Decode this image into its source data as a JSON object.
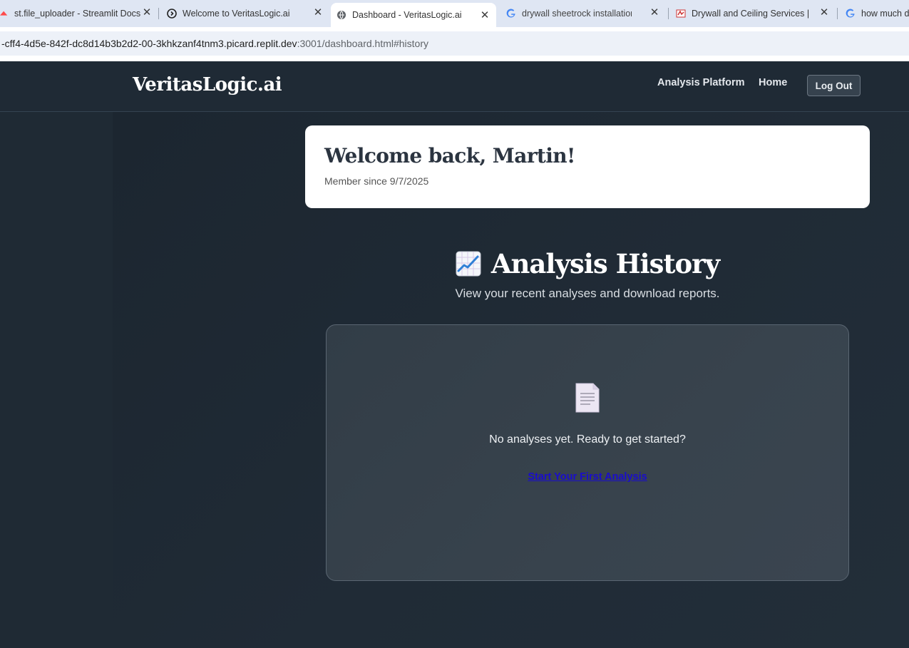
{
  "browser": {
    "tabs": [
      {
        "title": "st.file_uploader - Streamlit Docs",
        "favicon": "streamlit-icon"
      },
      {
        "title": "Welcome to VeritasLogic.ai",
        "favicon": "replit-icon"
      },
      {
        "title": "Dashboard - VeritasLogic.ai",
        "favicon": "globe-icon",
        "active": true
      },
      {
        "title": "drywall sheetrock installation co",
        "favicon": "google-icon"
      },
      {
        "title": "Drywall and Ceiling Services | M",
        "favicon": "site-icon"
      },
      {
        "title": "how much d",
        "favicon": "google-icon"
      }
    ],
    "url_host": "-cff4-4d5e-842f-dc8d14b3b2d2-00-3khkzanf4tnm3.picard.replit.dev",
    "url_path": ":3001/dashboard.html#history"
  },
  "nav": {
    "logo": "VeritasLogic.ai",
    "links": [
      "Analysis Platform",
      "Home"
    ],
    "logout_label": "Log Out"
  },
  "welcome": {
    "heading": "Welcome back, Martin!",
    "member_since": "Member since 9/7/2025"
  },
  "history": {
    "icon": "chart-increasing-icon",
    "title": "Analysis History",
    "subtitle": "View your recent analyses and download reports.",
    "empty_icon": "document-icon",
    "empty_message": "No analyses yet. Ready to get started?",
    "start_link": "Start Your First Analysis"
  },
  "colors": {
    "background": "#1e2832",
    "link": "#1a0dcc",
    "card": "#ffffff"
  }
}
